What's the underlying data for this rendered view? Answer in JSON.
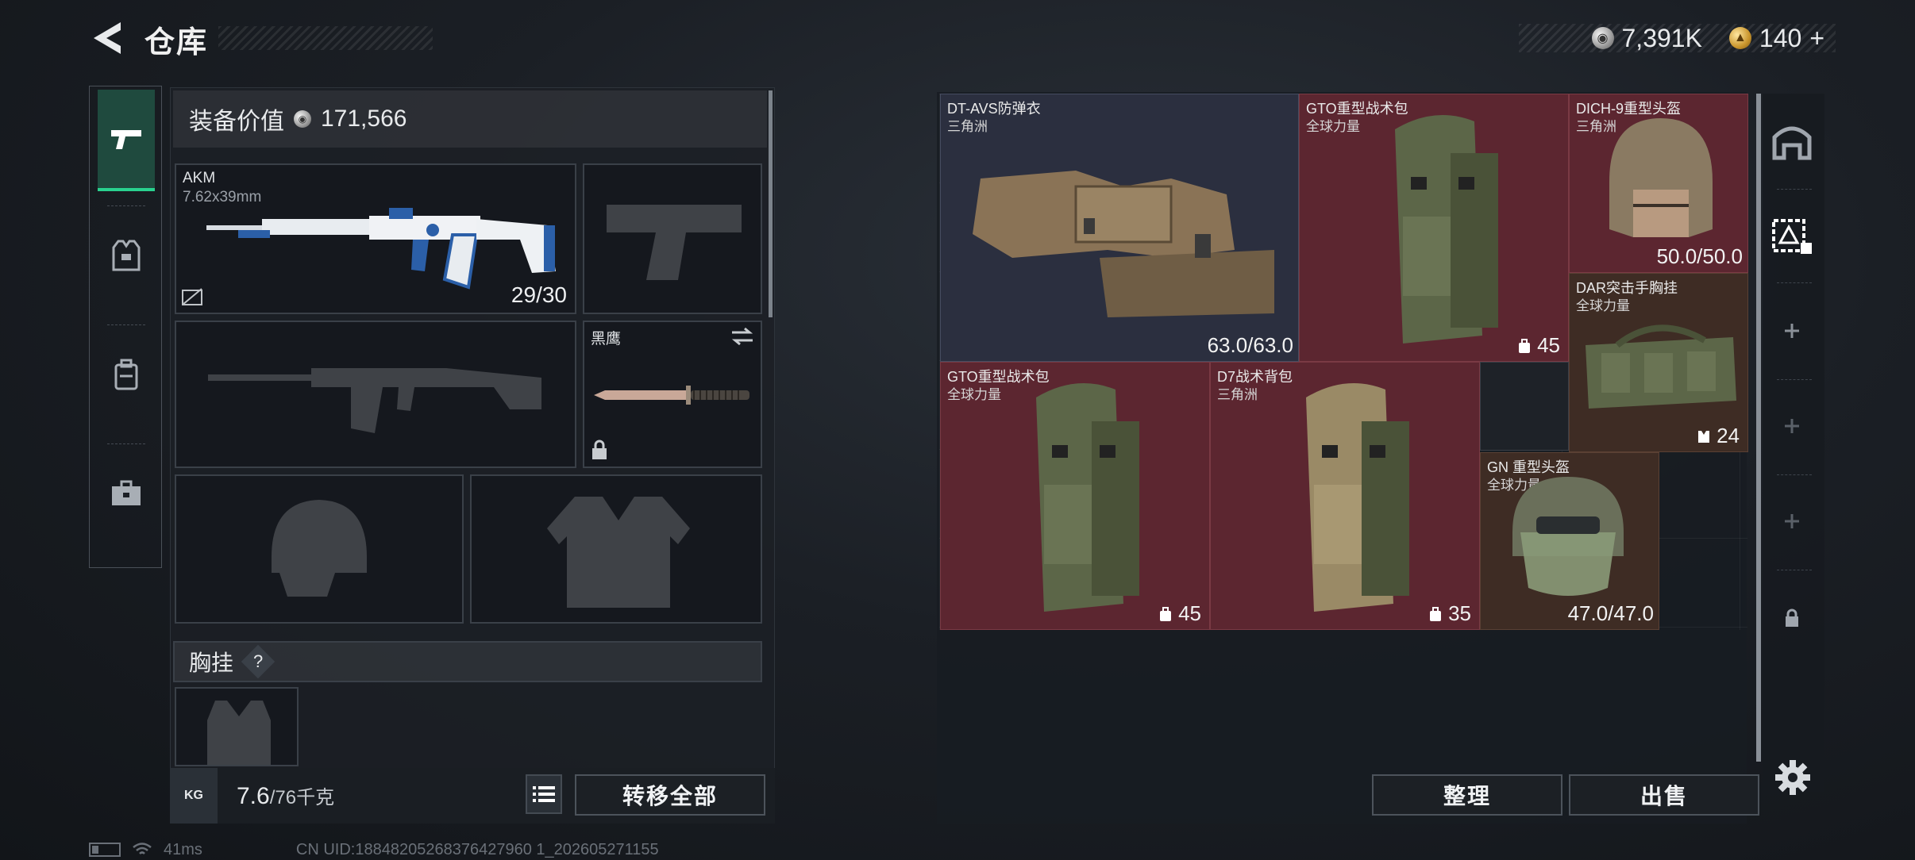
{
  "header": {
    "title": "仓库",
    "currency_silver": "7,391K",
    "currency_gold": "140",
    "gold_plus": "+"
  },
  "loadout": {
    "value_label": "装备价值",
    "value": "171,566",
    "primary": {
      "name": "AKM",
      "caliber": "7.62x39mm",
      "ammo": "29/30"
    },
    "melee": {
      "name": "黑鹰"
    },
    "vest_label": "胸挂",
    "vest_help": "?",
    "weight_icon": "KG",
    "weight_current": "7.6",
    "weight_max": "/76千克",
    "transfer_all": "转移全部"
  },
  "stash": {
    "items": [
      {
        "name": "DT-AVS防弹衣",
        "source": "三角洲",
        "durability": "63.0/63.0"
      },
      {
        "name": "GTO重型战术包",
        "source": "全球力量",
        "capacity": "45"
      },
      {
        "name": "DICH-9重型头盔",
        "source": "三角洲",
        "durability": "50.0/50.0"
      },
      {
        "name": "DAR突击手胸挂",
        "source": "全球力量",
        "capacity": "24"
      },
      {
        "name": "GTO重型战术包",
        "source": "全球力量",
        "capacity": "45"
      },
      {
        "name": "D7战术背包",
        "source": "三角洲",
        "capacity": "35"
      },
      {
        "name": "GN 重型头盔",
        "source": "全球力量",
        "durability": "47.0/47.0"
      }
    ],
    "sort_button": "整理",
    "sell_button": "出售"
  },
  "footer": {
    "ping": "41ms",
    "uid": "CN UID:18848205268376427960 1_202605271155"
  },
  "colors": {
    "accent_green": "#29d18f",
    "rarity_red": "#5c2630",
    "rarity_blue": "#2b2f3f",
    "rarity_brown": "#3e2c24"
  }
}
